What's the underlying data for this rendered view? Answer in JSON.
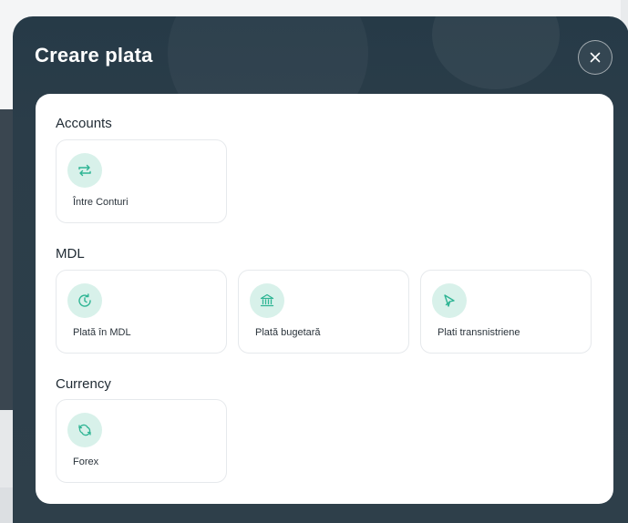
{
  "modal": {
    "title": "Creare plata",
    "close_icon": "close-icon"
  },
  "sections": [
    {
      "title": "Accounts",
      "cards": [
        {
          "label": "Între Conturi",
          "icon": "transfer-arrows-icon"
        }
      ]
    },
    {
      "title": "MDL",
      "cards": [
        {
          "label": "Plată în MDL",
          "icon": "clock-refresh-icon"
        },
        {
          "label": "Plată bugetară",
          "icon": "bank-icon"
        },
        {
          "label": "Plati transnistriene",
          "icon": "send-arrow-icon"
        }
      ]
    },
    {
      "title": "Currency",
      "cards": [
        {
          "label": "Forex",
          "icon": "exchange-icon"
        }
      ]
    }
  ],
  "colors": {
    "header_bg": "#263a47",
    "icon_bg": "#d8f1ea",
    "icon_stroke": "#2fb594",
    "panel_bg": "#ffffff"
  }
}
